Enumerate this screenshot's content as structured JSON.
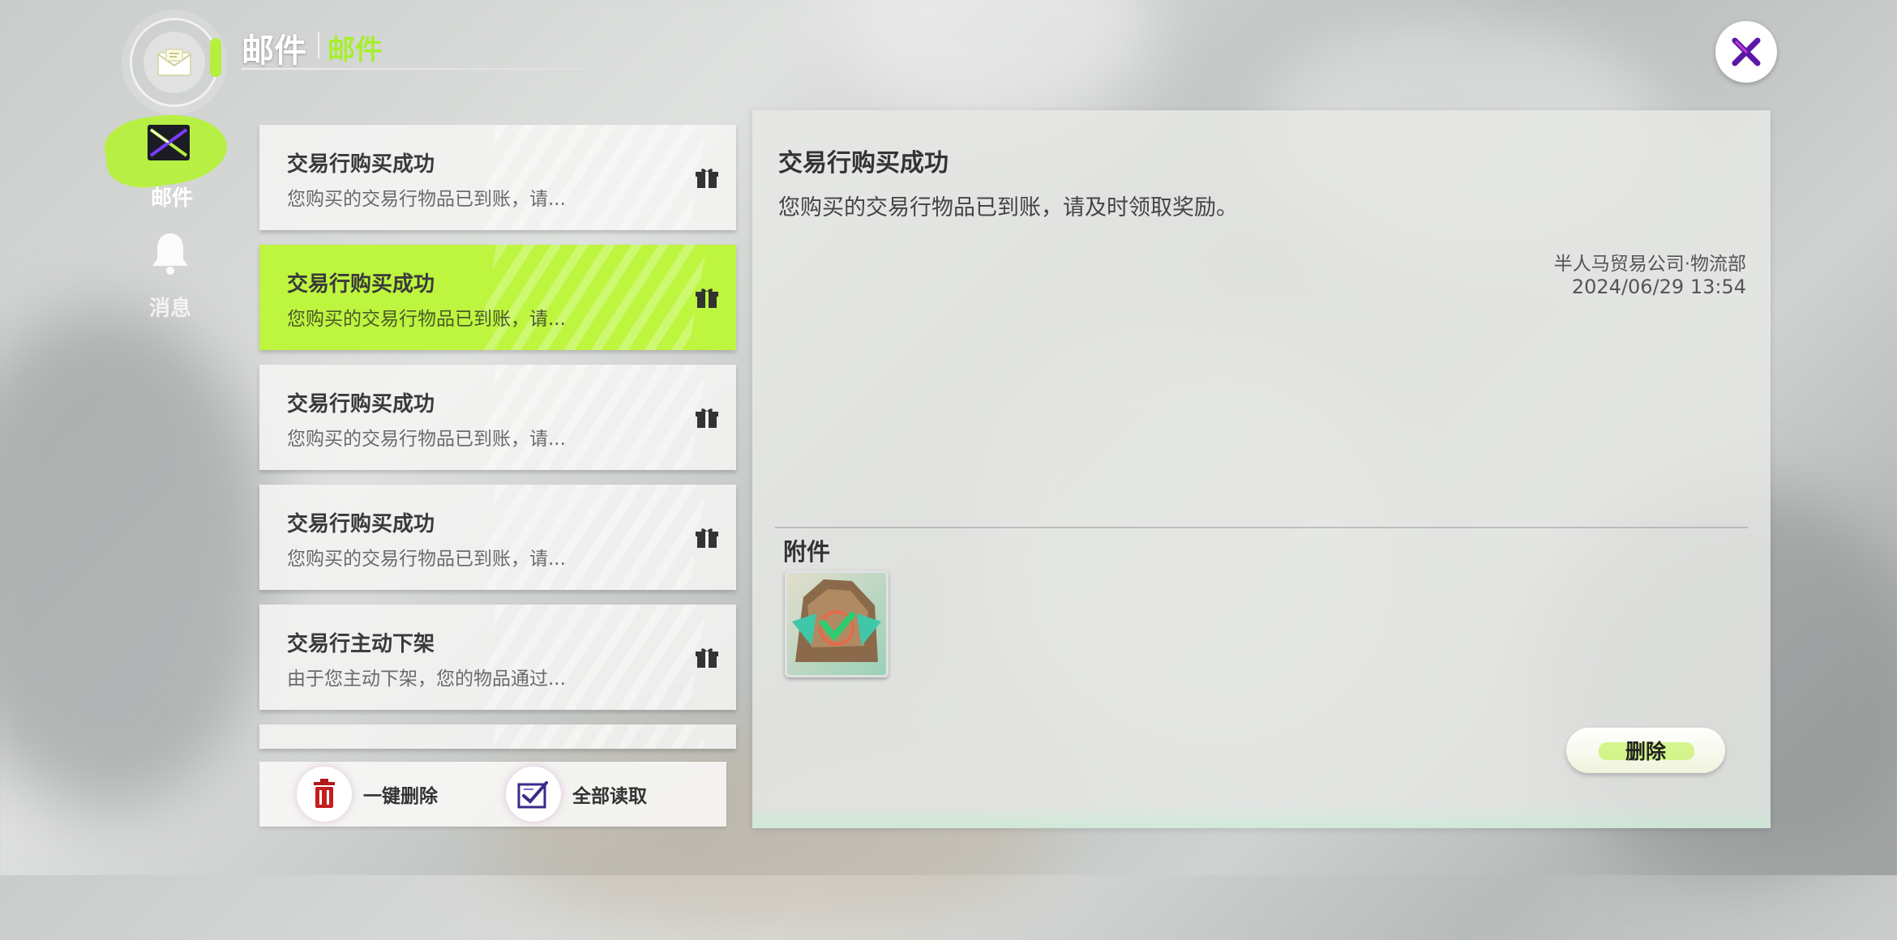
{
  "header": {
    "title": "邮件",
    "subtitle": "邮件"
  },
  "nav": {
    "items": [
      {
        "label": "邮件",
        "icon": "mail-icon",
        "active": true
      },
      {
        "label": "消息",
        "icon": "bell-icon",
        "active": false
      }
    ]
  },
  "mail_list": {
    "items": [
      {
        "title": "交易行购买成功",
        "snippet": "您购买的交易行物品已到账，请...",
        "icon": "gift-icon",
        "selected": false
      },
      {
        "title": "交易行购买成功",
        "snippet": "您购买的交易行物品已到账，请...",
        "icon": "gift-icon",
        "selected": true
      },
      {
        "title": "交易行购买成功",
        "snippet": "您购买的交易行物品已到账，请...",
        "icon": "gift-icon",
        "selected": false
      },
      {
        "title": "交易行购买成功",
        "snippet": "您购买的交易行物品已到账，请...",
        "icon": "gift-icon",
        "selected": false
      },
      {
        "title": "交易行主动下架",
        "snippet": "由于您主动下架，您的物品通过...",
        "icon": "gift-icon",
        "selected": false
      }
    ],
    "delete_all_label": "一键删除",
    "read_all_label": "全部读取"
  },
  "detail": {
    "title": "交易行购买成功",
    "body": "您购买的交易行物品已到账，请及时领取奖励。",
    "sender": "半人马贸易公司·物流部",
    "date": "2024/06/29  13:54",
    "attachments_label": "附件",
    "delete_label": "删除"
  },
  "colors": {
    "accent": "#bdf53f",
    "close_icon": "#6a1bb0"
  }
}
